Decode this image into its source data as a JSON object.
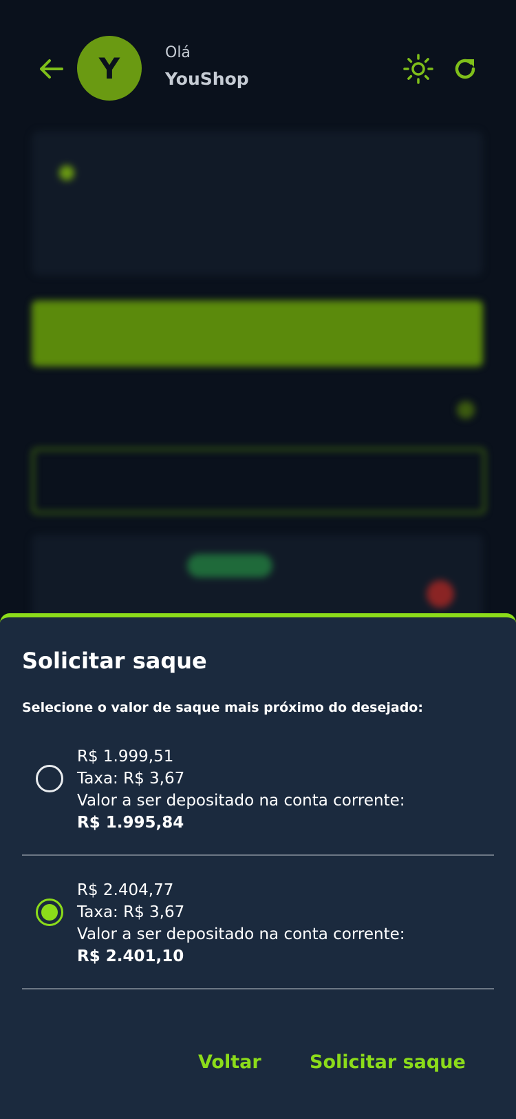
{
  "header": {
    "avatar_letter": "Y",
    "greeting": "Olá",
    "shop_name": "YouShop"
  },
  "colors": {
    "accent": "#8cdc1a",
    "background": "#0a111c",
    "sheet": "#1b2a3e"
  },
  "icons": {
    "back": "arrow-left-icon",
    "theme": "sun-icon",
    "refresh": "refresh-icon"
  },
  "sheet": {
    "title": "Solicitar saque",
    "instruction": "Selecione o valor de saque mais próximo do desejado:",
    "options": [
      {
        "amount": "R$ 1.999,51",
        "fee": "Taxa: R$ 3,67",
        "deposit_label": "Valor a ser depositado na conta corrente:",
        "deposit_value": "R$ 1.995,84",
        "selected": false
      },
      {
        "amount": "R$ 2.404,77",
        "fee": "Taxa: R$ 3,67",
        "deposit_label": "Valor a ser depositado na conta corrente:",
        "deposit_value": "R$ 2.401,10",
        "selected": true
      }
    ],
    "back_label": "Voltar",
    "submit_label": "Solicitar saque"
  }
}
